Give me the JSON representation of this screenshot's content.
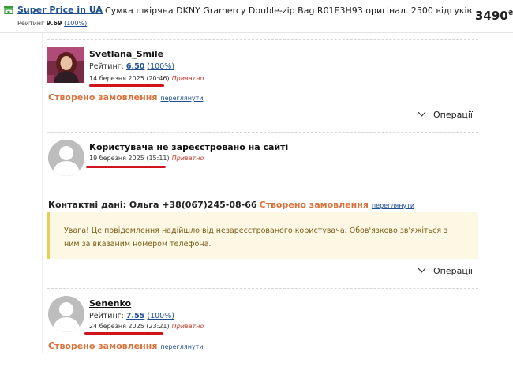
{
  "header": {
    "store_name": "Super Price in UA",
    "store_rating_label": "Рейтинг",
    "store_rating_value": "9.69",
    "store_rating_percent": "(100%)",
    "product_title": "Сумка шкіряна DKNY Gramercy Double-zip Bag R01E3H93 оригінал. 2500 відгуків",
    "price": "3490",
    "currency": "₴"
  },
  "reviews": [
    {
      "name": "Svetlana_Smile",
      "rating_label": "Рейтинг:",
      "rating_value": "6.50",
      "rating_percent": "(100%)",
      "date": "14 березня 2025 (20:46)",
      "privacy": "Приватно",
      "order_text": "Створено замовлення",
      "view_link": "переглянути"
    },
    {
      "name": "Користувача не зареєстровано на сайті",
      "date": "19 березня 2025 (15:11)",
      "privacy": "Приватно",
      "contact_text": "Контактні дані: Ольга +38(067)245-08-66",
      "order_text": "Створено замовлення",
      "view_link": "переглянути",
      "warning": "Увага! Це повідомлення надійшло від незареєстрованого користувача. Обов'язково зв'яжіться з ним за вказаним номером телефона."
    },
    {
      "name": "Senenko",
      "rating_label": "Рейтинг:",
      "rating_value": "7.55",
      "rating_percent": "(100%)",
      "date": "24 березня 2025 (23:21)",
      "privacy": "Приватно",
      "order_text": "Створено замовлення",
      "view_link": "переглянути"
    }
  ],
  "operations_label": "Операції",
  "colors": {
    "link_blue": "#1d4f91",
    "order_orange": "#d9713a",
    "private_red": "#c0392b",
    "annotation_red": "#d0141e",
    "warning_bg": "#fdf8e4",
    "warning_border": "#e8cf5c",
    "store_icon_green": "#3a9a3a"
  },
  "icons": [
    "store-icon",
    "avatar-placeholder-icon",
    "chevron-down-icon"
  ]
}
